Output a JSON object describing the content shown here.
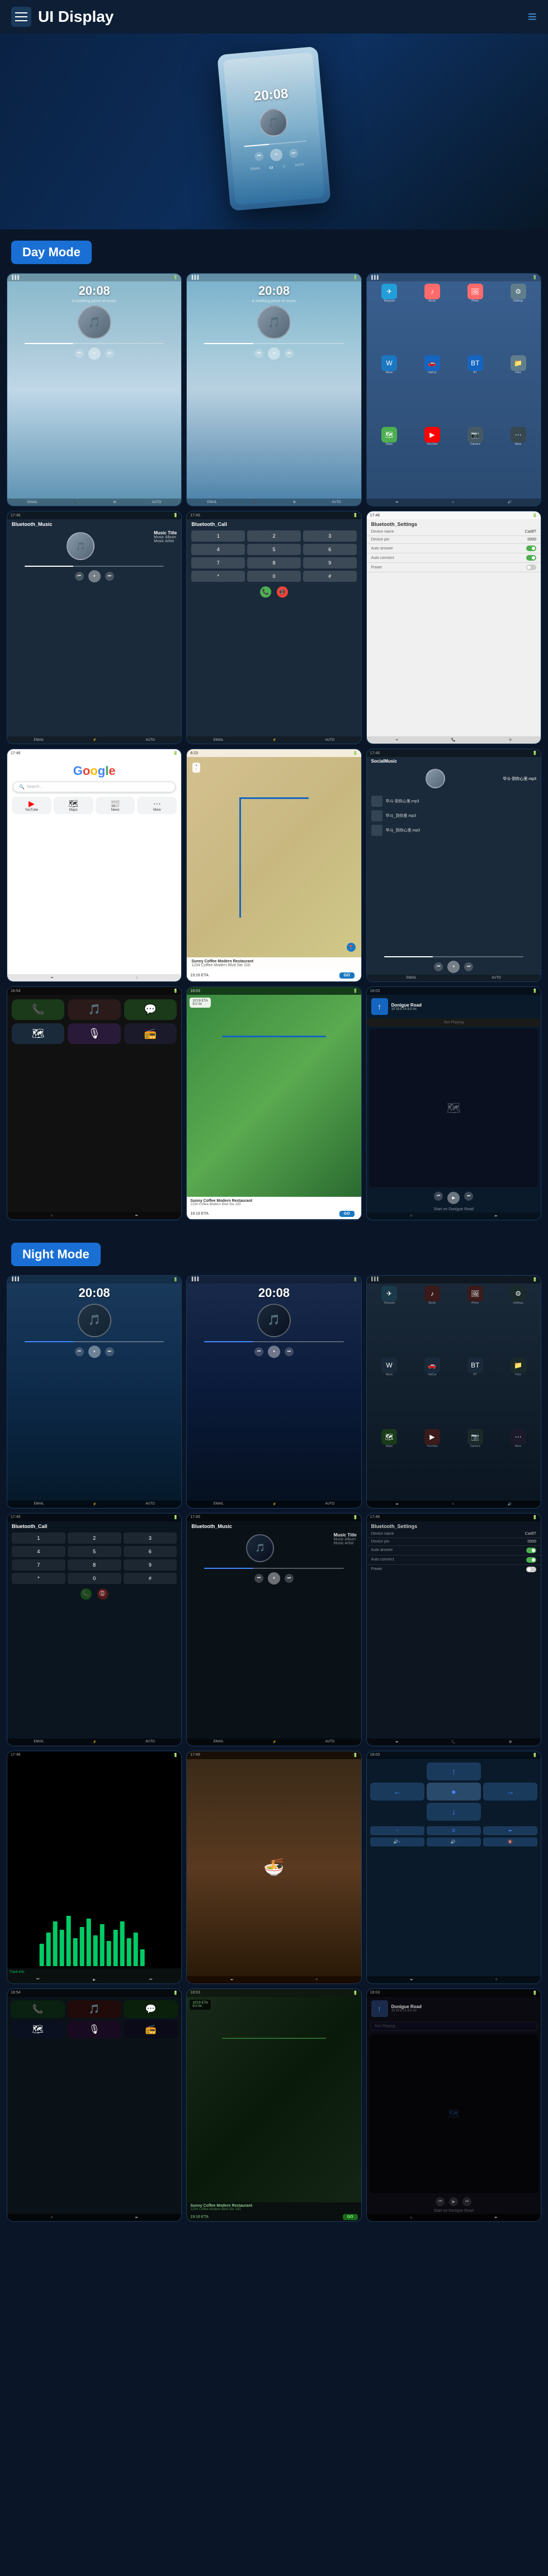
{
  "header": {
    "title": "UI Display",
    "menu_icon": "≡",
    "nav_icon": "≡"
  },
  "hero": {
    "time": "20:08"
  },
  "day_mode": {
    "label": "Day Mode",
    "screens": [
      {
        "id": "music1",
        "type": "music_day",
        "time": "20:08",
        "subtitle": "A soothing piece of music",
        "song": ""
      },
      {
        "id": "music2",
        "type": "music_day2",
        "time": "20:08",
        "subtitle": "A soothing piece of music",
        "song": ""
      },
      {
        "id": "apps1",
        "type": "apps_day",
        "subtitle": ""
      },
      {
        "id": "bt_music",
        "type": "bluetooth_music",
        "title": "Bluetooth_Music"
      },
      {
        "id": "bt_call",
        "type": "bluetooth_call",
        "title": "Bluetooth_Call"
      },
      {
        "id": "settings1",
        "type": "settings",
        "title": "Bluetooth_Settings"
      },
      {
        "id": "google",
        "type": "google"
      },
      {
        "id": "map1",
        "type": "map"
      },
      {
        "id": "social",
        "type": "social_music"
      },
      {
        "id": "carplay1",
        "type": "carplay"
      },
      {
        "id": "carplay2",
        "type": "carplay_map"
      },
      {
        "id": "carplay3",
        "type": "carplay_nav"
      }
    ]
  },
  "night_mode": {
    "label": "Night Mode",
    "screens": [
      {
        "id": "n_music1",
        "type": "music_night",
        "time": "20:08"
      },
      {
        "id": "n_music2",
        "type": "music_night2",
        "time": "20:08"
      },
      {
        "id": "n_apps1",
        "type": "apps_night"
      },
      {
        "id": "n_bt_call",
        "type": "bt_call_night",
        "title": "Bluetooth_Call"
      },
      {
        "id": "n_bt_music",
        "type": "bt_music_night",
        "title": "Bluetooth_Music"
      },
      {
        "id": "n_settings",
        "type": "settings_night",
        "title": "Bluetooth_Settings"
      },
      {
        "id": "n_eq",
        "type": "equalizer"
      },
      {
        "id": "n_food",
        "type": "food"
      },
      {
        "id": "n_nav",
        "type": "nav_night"
      },
      {
        "id": "n_cp1",
        "type": "carplay_night"
      },
      {
        "id": "n_map",
        "type": "map_night"
      },
      {
        "id": "n_nav2",
        "type": "nav2_night"
      }
    ]
  },
  "music_info": {
    "title": "Music Title",
    "album": "Music Album",
    "artist": "Music Artist"
  },
  "settings": {
    "device_name_label": "Device name",
    "device_name_val": "CarBT",
    "device_pin_label": "Device pin",
    "device_pin_val": "0000",
    "auto_answer_label": "Auto answer",
    "auto_connect_label": "Auto connect",
    "power_label": "Power"
  },
  "restaurant": {
    "name": "Sunny Coffee Modern Restaurant",
    "address": "1234 Coffee Modern Blvd Ste 100",
    "eta_label": "19:19 ETA",
    "distance": "9.0 mi",
    "go_label": "GO"
  },
  "nav": {
    "road": "Donigue Road",
    "distance": "10'19 ETA   9.0 mi"
  }
}
